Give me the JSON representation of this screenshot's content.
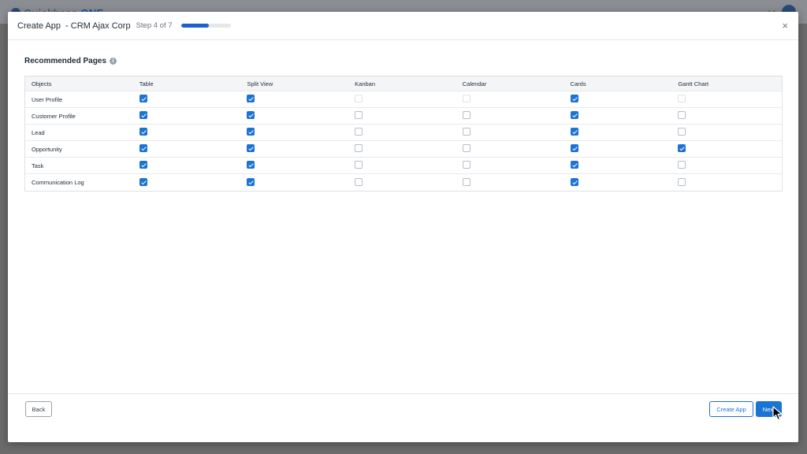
{
  "background_app": {
    "brand_prefix": "Quickbase",
    "brand_suffix": "ONE"
  },
  "modal": {
    "title": "Create App",
    "subtitle": "- CRM Ajax Corp",
    "step": "Step 4 of 7",
    "progress_fraction": 0.57,
    "close_label": "×"
  },
  "section": {
    "title": "Recommended Pages",
    "info_icon": "i"
  },
  "table": {
    "columns": [
      "Objects",
      "Table",
      "Split View",
      "Kanban",
      "Calendar",
      "Cards",
      "Gantt Chart"
    ],
    "rows": [
      {
        "name": "User Profile",
        "values": [
          true,
          true,
          false,
          false,
          true,
          false
        ],
        "disabled": [
          false,
          false,
          true,
          true,
          false,
          true
        ]
      },
      {
        "name": "Customer Profile",
        "values": [
          true,
          true,
          false,
          false,
          true,
          false
        ],
        "disabled": [
          false,
          false,
          false,
          false,
          false,
          false
        ]
      },
      {
        "name": "Lead",
        "values": [
          true,
          true,
          false,
          false,
          true,
          false
        ],
        "disabled": [
          false,
          false,
          false,
          false,
          false,
          false
        ]
      },
      {
        "name": "Opportunity",
        "values": [
          true,
          true,
          false,
          false,
          true,
          true
        ],
        "disabled": [
          false,
          false,
          false,
          false,
          false,
          false
        ]
      },
      {
        "name": "Task",
        "values": [
          true,
          true,
          false,
          false,
          true,
          false
        ],
        "disabled": [
          false,
          false,
          false,
          false,
          false,
          false
        ]
      },
      {
        "name": "Communication Log",
        "values": [
          true,
          true,
          false,
          false,
          true,
          false
        ],
        "disabled": [
          false,
          false,
          false,
          false,
          false,
          false
        ]
      }
    ]
  },
  "footer": {
    "back_label": "Back",
    "create_label": "Create App",
    "next_label": "Next"
  },
  "colors": {
    "accent": "#1b73d3",
    "progress": "#1d5fd1"
  },
  "icons": [
    "info-icon",
    "close-icon",
    "checkbox-icon",
    "mouse-pointer-icon"
  ]
}
